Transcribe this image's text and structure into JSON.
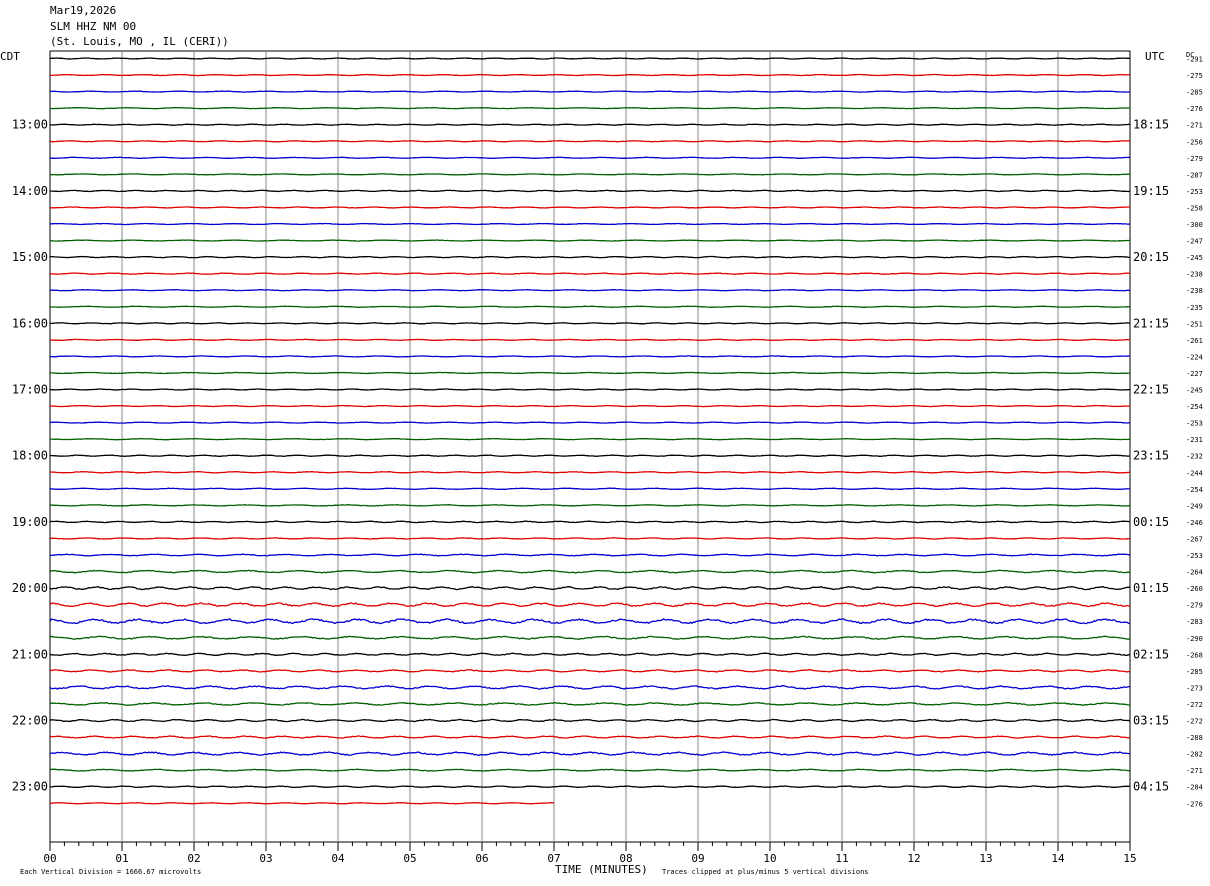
{
  "header": {
    "date": "Mar19,2026",
    "station": "SLM HHZ NM 00",
    "location": "(St. Louis, MO , IL (CERI))"
  },
  "left_timezone": "CDT",
  "right_timezone": "UTC",
  "dc_label": "DC",
  "footer": {
    "x_axis_title": "TIME (MINUTES)",
    "scale_note": "Each Vertical Division = 1666.67 microvolts",
    "clip_note": "Traces clipped at plus/minus 5 vertical divisions"
  },
  "chart_data": {
    "type": "line",
    "title": "SLM HHZ NM 00",
    "xlabel": "TIME (MINUTES)",
    "xlim": [
      0,
      15
    ],
    "x_ticks": [
      "00",
      "01",
      "02",
      "03",
      "04",
      "05",
      "06",
      "07",
      "08",
      "09",
      "10",
      "11",
      "12",
      "13",
      "14",
      "15"
    ],
    "trace_colors": [
      "#000000",
      "#e00000",
      "#0000d0",
      "#006000"
    ],
    "left_hour_labels": [
      "13:00",
      "14:00",
      "15:00",
      "16:00",
      "17:00",
      "18:00",
      "19:00",
      "20:00",
      "21:00",
      "22:00",
      "23:00"
    ],
    "right_hour_labels": [
      "18:15",
      "19:15",
      "20:15",
      "21:15",
      "22:15",
      "23:15",
      "00:15",
      "01:15",
      "02:15",
      "03:15",
      "04:15"
    ],
    "dc_offsets": [
      "-291",
      "-275",
      "-285",
      "-276",
      "-271",
      "-256",
      "-279",
      "-287",
      "-253",
      "-258",
      "-300",
      "-247",
      "-245",
      "-238",
      "-238",
      "-235",
      "-251",
      "-261",
      "-224",
      "-227",
      "-245",
      "-254",
      "-253",
      "-231",
      "-232",
      "-244",
      "-254",
      "-249",
      "-246",
      "-267",
      "-253",
      "-264",
      "-260",
      "-279",
      "-283",
      "-290",
      "-268",
      "-285",
      "-273",
      "-272",
      "-272",
      "-288",
      "-282",
      "-271",
      "-284",
      "-276"
    ],
    "trace_count": 46,
    "last_trace_end_minute": 7.0,
    "amplitude_divisions": [
      0.3,
      0.3,
      0.3,
      0.3,
      0.3,
      0.3,
      0.3,
      0.3,
      0.35,
      0.3,
      0.3,
      0.3,
      0.35,
      0.35,
      0.3,
      0.3,
      0.3,
      0.3,
      0.3,
      0.3,
      0.3,
      0.3,
      0.3,
      0.3,
      0.35,
      0.35,
      0.35,
      0.35,
      0.4,
      0.35,
      0.5,
      0.7,
      0.8,
      1.0,
      1.3,
      0.8,
      0.6,
      0.6,
      0.9,
      0.7,
      0.6,
      0.6,
      0.9,
      0.5,
      0.4,
      0.3
    ]
  }
}
